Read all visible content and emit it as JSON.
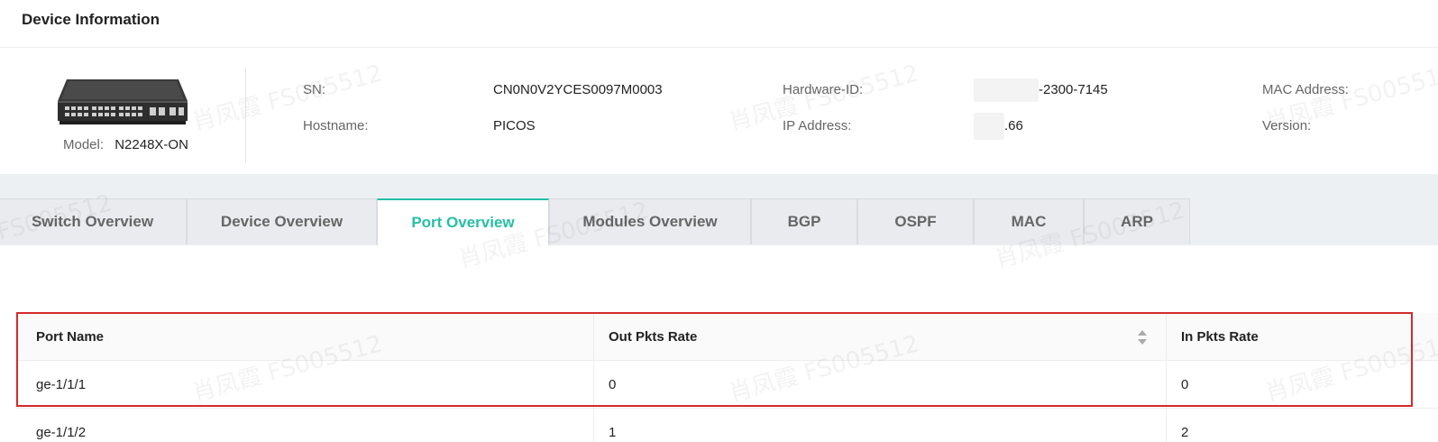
{
  "header": {
    "title": "Device Information"
  },
  "device": {
    "model_label": "Model:",
    "model_value": "N2248X-ON",
    "fields": [
      {
        "label": "SN:",
        "value": "CN0N0V2YCES0097M0003"
      },
      {
        "label": "Hostname:",
        "value": "PICOS"
      },
      {
        "label": "Hardware-ID:",
        "value": "-2300-7145"
      },
      {
        "label": "IP Address:",
        "value": ".66"
      },
      {
        "label": "MAC Address:",
        "value": ""
      },
      {
        "label": "Version:",
        "value": ""
      }
    ]
  },
  "tabs": [
    {
      "label": "Switch Overview",
      "active": false
    },
    {
      "label": "Device Overview",
      "active": false
    },
    {
      "label": "Port Overview",
      "active": true
    },
    {
      "label": "Modules Overview",
      "active": false
    },
    {
      "label": "BGP",
      "active": false
    },
    {
      "label": "OSPF",
      "active": false
    },
    {
      "label": "MAC",
      "active": false
    },
    {
      "label": "ARP",
      "active": false
    }
  ],
  "table": {
    "columns": [
      "Port Name",
      "Out Pkts Rate",
      "In Pkts Rate"
    ],
    "rows": [
      [
        "ge-1/1/1",
        "0",
        "0"
      ],
      [
        "ge-1/1/2",
        "1",
        "2"
      ]
    ]
  },
  "watermark": "肖凤霞 FS005512",
  "colors": {
    "accent": "#26bfa5",
    "highlight": "#d42a2a",
    "tab_bg": "#e9ebee"
  },
  "icons": [
    "switch-device-image",
    "sort-icon"
  ]
}
